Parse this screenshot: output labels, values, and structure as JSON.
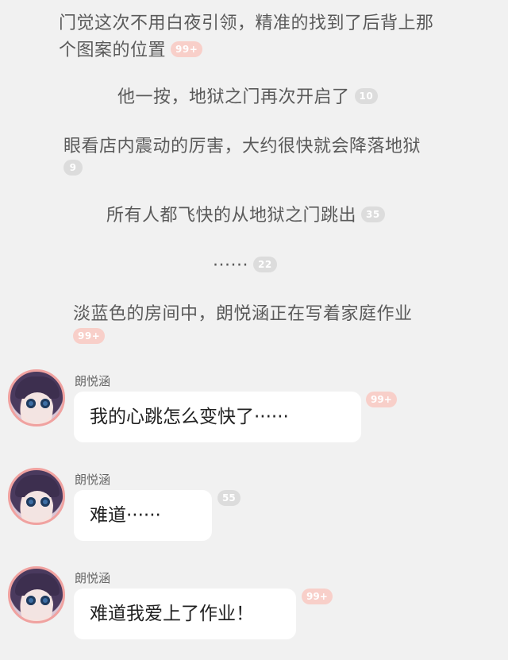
{
  "narration": [
    {
      "line1": "门觉这次不用白夜引领，精准的找到了后背上那",
      "line2": "个图案的位置",
      "badge": "99+",
      "badge_style": "hot"
    },
    {
      "text": "他一按，地狱之门再次开启了",
      "badge": "10",
      "badge_style": "grey"
    },
    {
      "text": "眼看店内震动的厉害，大约很快就会降落地狱",
      "badge": "9",
      "badge_style": "grey"
    },
    {
      "text": "所有人都飞快的从地狱之门跳出",
      "badge": "35",
      "badge_style": "grey"
    },
    {
      "text": "······",
      "badge": "22",
      "badge_style": "grey"
    },
    {
      "text": "淡蓝色的房间中，朗悦涵正在写着家庭作业",
      "badge": "99+",
      "badge_style": "hot"
    }
  ],
  "messages": [
    {
      "sender": "朗悦涵",
      "text": "我的心跳怎么变快了······",
      "badge": "99+",
      "badge_style": "hot"
    },
    {
      "sender": "朗悦涵",
      "text": "难道······",
      "badge": "55",
      "badge_style": "grey"
    },
    {
      "sender": "朗悦涵",
      "text": "难道我爱上了作业！",
      "badge": "99+",
      "badge_style": "hot"
    }
  ],
  "colors": {
    "background": "#f1f1f1",
    "bubble": "#ffffff",
    "badge_hot": "#f8cfc9",
    "badge_grey": "#dcdcdc",
    "avatar_ring": "#f0a2a0"
  }
}
